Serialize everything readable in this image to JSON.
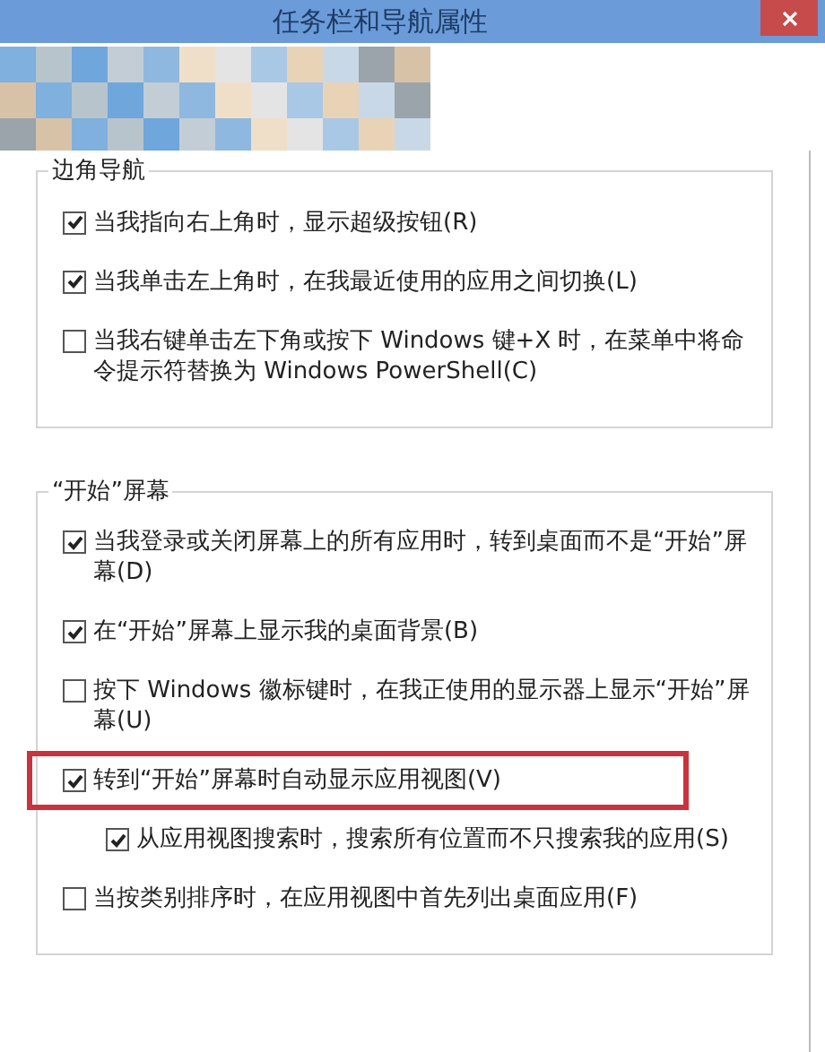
{
  "window": {
    "title": "任务栏和导航属性"
  },
  "groups": [
    {
      "title": "边角导航",
      "options": [
        {
          "label": "当我指向右上角时，显示超级按钮(R)",
          "checked": true,
          "highlighted": false
        },
        {
          "label": "当我单击左上角时，在我最近使用的应用之间切换(L)",
          "checked": true,
          "highlighted": false
        },
        {
          "label": "当我右键单击左下角或按下 Windows 键+X 时，在菜单中将命令提示符替换为 Windows PowerShell(C)",
          "checked": false,
          "highlighted": false
        }
      ]
    },
    {
      "title": "“开始”屏幕",
      "options": [
        {
          "label": "当我登录或关闭屏幕上的所有应用时，转到桌面而不是“开始”屏幕(D)",
          "checked": true,
          "highlighted": false
        },
        {
          "label": "在“开始”屏幕上显示我的桌面背景(B)",
          "checked": true,
          "highlighted": false
        },
        {
          "label": "按下 Windows 徽标键时，在我正使用的显示器上显示“开始”屏幕(U)",
          "checked": false,
          "highlighted": false
        },
        {
          "label": "转到“开始”屏幕时自动显示应用视图(V)",
          "checked": true,
          "highlighted": true,
          "children": [
            {
              "label": "从应用视图搜索时，搜索所有位置而不只搜索我的应用(S)",
              "checked": true,
              "highlighted": false
            }
          ]
        },
        {
          "label": "当按类别排序时，在应用视图中首先列出桌面应用(F)",
          "checked": false,
          "highlighted": false
        }
      ]
    }
  ]
}
